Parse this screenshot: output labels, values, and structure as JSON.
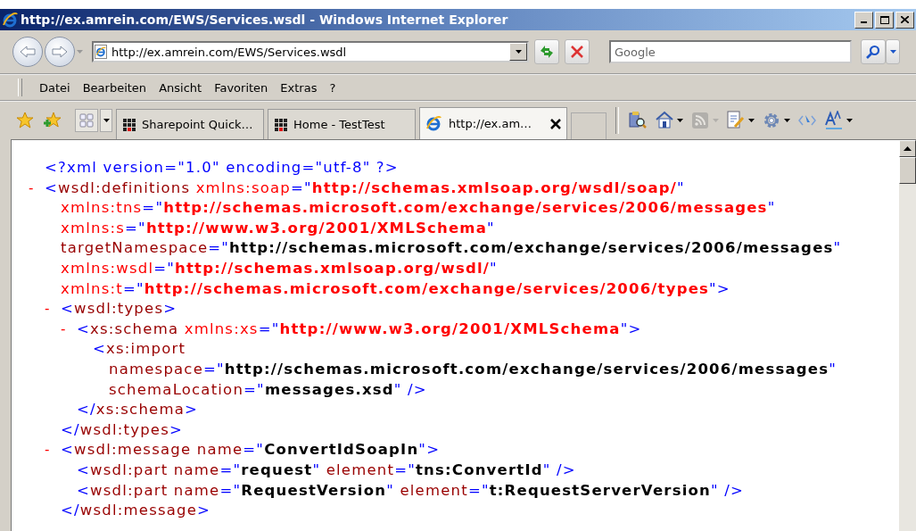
{
  "window": {
    "title": "http://ex.amrein.com/EWS/Services.wsdl - Windows Internet Explorer"
  },
  "navigation": {
    "address": "http://ex.amrein.com/EWS/Services.wsdl",
    "search": {
      "placeholder": "Google"
    }
  },
  "menu": [
    "Datei",
    "Bearbeiten",
    "Ansicht",
    "Favoriten",
    "Extras",
    "?"
  ],
  "tabs": [
    {
      "label": "Sharepoint Quick…",
      "selected": false
    },
    {
      "label": "Home - TestTest",
      "selected": false
    },
    {
      "label": "http://ex.am…",
      "selected": true
    }
  ],
  "command_bar": [
    {
      "kind": "research",
      "menu": false,
      "disabled": false
    },
    {
      "kind": "home",
      "menu": true,
      "disabled": false
    },
    {
      "kind": "feeds",
      "menu": true,
      "disabled": true
    },
    {
      "kind": "page",
      "menu": true,
      "disabled": false
    },
    {
      "kind": "tools",
      "menu": true,
      "disabled": false
    },
    {
      "kind": "select",
      "menu": false,
      "disabled": false
    },
    {
      "kind": "font",
      "menu": true,
      "disabled": false
    }
  ],
  "document": {
    "nodes": [
      {
        "open": [
          [
            {
              "kind": "punct",
              "text": "<?xml version=\"1.0\" encoding=\"utf-8\" ?>"
            }
          ]
        ]
      },
      {
        "toggle": "-",
        "open": [
          [
            {
              "kind": "punct",
              "text": "<"
            },
            {
              "kind": "tag",
              "text": "wsdl:definitions"
            },
            {
              "kind": "xmlns-attr",
              "text": " xmlns:soap"
            },
            {
              "kind": "punct",
              "text": "=\""
            },
            {
              "kind": "xmlns-value",
              "text": "http://schemas.xmlsoap.org/wsdl/soap/"
            },
            {
              "kind": "punct",
              "text": "\""
            }
          ],
          [
            {
              "kind": "xmlns-attr",
              "text": "xmlns:tns"
            },
            {
              "kind": "punct",
              "text": "=\""
            },
            {
              "kind": "xmlns-value",
              "text": "http://schemas.microsoft.com/exchange/services/2006/messages"
            },
            {
              "kind": "punct",
              "text": "\""
            }
          ],
          [
            {
              "kind": "xmlns-attr",
              "text": "xmlns:s"
            },
            {
              "kind": "punct",
              "text": "=\""
            },
            {
              "kind": "xmlns-value",
              "text": "http://www.w3.org/2001/XMLSchema"
            },
            {
              "kind": "punct",
              "text": "\""
            }
          ],
          [
            {
              "kind": "attr",
              "text": "targetNamespace"
            },
            {
              "kind": "punct",
              "text": "=\""
            },
            {
              "kind": "value",
              "text": "http://schemas.microsoft.com/exchange/services/2006/messages"
            },
            {
              "kind": "punct",
              "text": "\""
            }
          ],
          [
            {
              "kind": "xmlns-attr",
              "text": "xmlns:wsdl"
            },
            {
              "kind": "punct",
              "text": "=\""
            },
            {
              "kind": "xmlns-value",
              "text": "http://schemas.xmlsoap.org/wsdl/"
            },
            {
              "kind": "punct",
              "text": "\""
            }
          ],
          [
            {
              "kind": "xmlns-attr",
              "text": "xmlns:t"
            },
            {
              "kind": "punct",
              "text": "=\""
            },
            {
              "kind": "xmlns-value",
              "text": "http://schemas.microsoft.com/exchange/services/2006/types"
            },
            {
              "kind": "punct",
              "text": "\">"
            }
          ]
        ],
        "children": [
          {
            "toggle": "-",
            "open": [
              [
                {
                  "kind": "punct",
                  "text": "<"
                },
                {
                  "kind": "tag",
                  "text": "wsdl:types"
                },
                {
                  "kind": "punct",
                  "text": ">"
                }
              ]
            ],
            "children": [
              {
                "toggle": "-",
                "open": [
                  [
                    {
                      "kind": "punct",
                      "text": "<"
                    },
                    {
                      "kind": "tag",
                      "text": "xs:schema"
                    },
                    {
                      "kind": "xmlns-attr",
                      "text": " xmlns:xs"
                    },
                    {
                      "kind": "punct",
                      "text": "=\""
                    },
                    {
                      "kind": "xmlns-value",
                      "text": "http://www.w3.org/2001/XMLSchema"
                    },
                    {
                      "kind": "punct",
                      "text": "\">"
                    }
                  ]
                ],
                "children": [
                  {
                    "open": [
                      [
                        {
                          "kind": "punct",
                          "text": "<"
                        },
                        {
                          "kind": "tag",
                          "text": "xs:import"
                        }
                      ],
                      [
                        {
                          "kind": "attr",
                          "text": "namespace"
                        },
                        {
                          "kind": "punct",
                          "text": "=\""
                        },
                        {
                          "kind": "value",
                          "text": "http://schemas.microsoft.com/exchange/services/2006/messages"
                        },
                        {
                          "kind": "punct",
                          "text": "\""
                        }
                      ],
                      [
                        {
                          "kind": "attr",
                          "text": "schemaLocation"
                        },
                        {
                          "kind": "punct",
                          "text": "=\""
                        },
                        {
                          "kind": "value",
                          "text": "messages.xsd"
                        },
                        {
                          "kind": "punct",
                          "text": "\" />"
                        }
                      ]
                    ]
                  }
                ],
                "close": [
                  {
                    "kind": "punct",
                    "text": "</"
                  },
                  {
                    "kind": "tag",
                    "text": "xs:schema"
                  },
                  {
                    "kind": "punct",
                    "text": ">"
                  }
                ]
              }
            ],
            "close": [
              {
                "kind": "punct",
                "text": "</"
              },
              {
                "kind": "tag",
                "text": "wsdl:types"
              },
              {
                "kind": "punct",
                "text": ">"
              }
            ]
          },
          {
            "toggle": "-",
            "open": [
              [
                {
                  "kind": "punct",
                  "text": "<"
                },
                {
                  "kind": "tag",
                  "text": "wsdl:message"
                },
                {
                  "kind": "attr",
                  "text": " name"
                },
                {
                  "kind": "punct",
                  "text": "=\""
                },
                {
                  "kind": "value",
                  "text": "ConvertIdSoapIn"
                },
                {
                  "kind": "punct",
                  "text": "\">"
                }
              ]
            ],
            "children": [
              {
                "open": [
                  [
                    {
                      "kind": "punct",
                      "text": "<"
                    },
                    {
                      "kind": "tag",
                      "text": "wsdl:part"
                    },
                    {
                      "kind": "attr",
                      "text": " name"
                    },
                    {
                      "kind": "punct",
                      "text": "=\""
                    },
                    {
                      "kind": "value",
                      "text": "request"
                    },
                    {
                      "kind": "punct",
                      "text": "\""
                    },
                    {
                      "kind": "attr",
                      "text": " element"
                    },
                    {
                      "kind": "punct",
                      "text": "=\""
                    },
                    {
                      "kind": "value",
                      "text": "tns:ConvertId"
                    },
                    {
                      "kind": "punct",
                      "text": "\" />"
                    }
                  ]
                ]
              },
              {
                "open": [
                  [
                    {
                      "kind": "punct",
                      "text": "<"
                    },
                    {
                      "kind": "tag",
                      "text": "wsdl:part"
                    },
                    {
                      "kind": "attr",
                      "text": " name"
                    },
                    {
                      "kind": "punct",
                      "text": "=\""
                    },
                    {
                      "kind": "value",
                      "text": "RequestVersion"
                    },
                    {
                      "kind": "punct",
                      "text": "\""
                    },
                    {
                      "kind": "attr",
                      "text": " element"
                    },
                    {
                      "kind": "punct",
                      "text": "=\""
                    },
                    {
                      "kind": "value",
                      "text": "t:RequestServerVersion"
                    },
                    {
                      "kind": "punct",
                      "text": "\" />"
                    }
                  ]
                ]
              }
            ],
            "close": [
              {
                "kind": "punct",
                "text": "</"
              },
              {
                "kind": "tag",
                "text": "wsdl:message"
              },
              {
                "kind": "punct",
                "text": ">"
              }
            ]
          }
        ]
      }
    ]
  }
}
